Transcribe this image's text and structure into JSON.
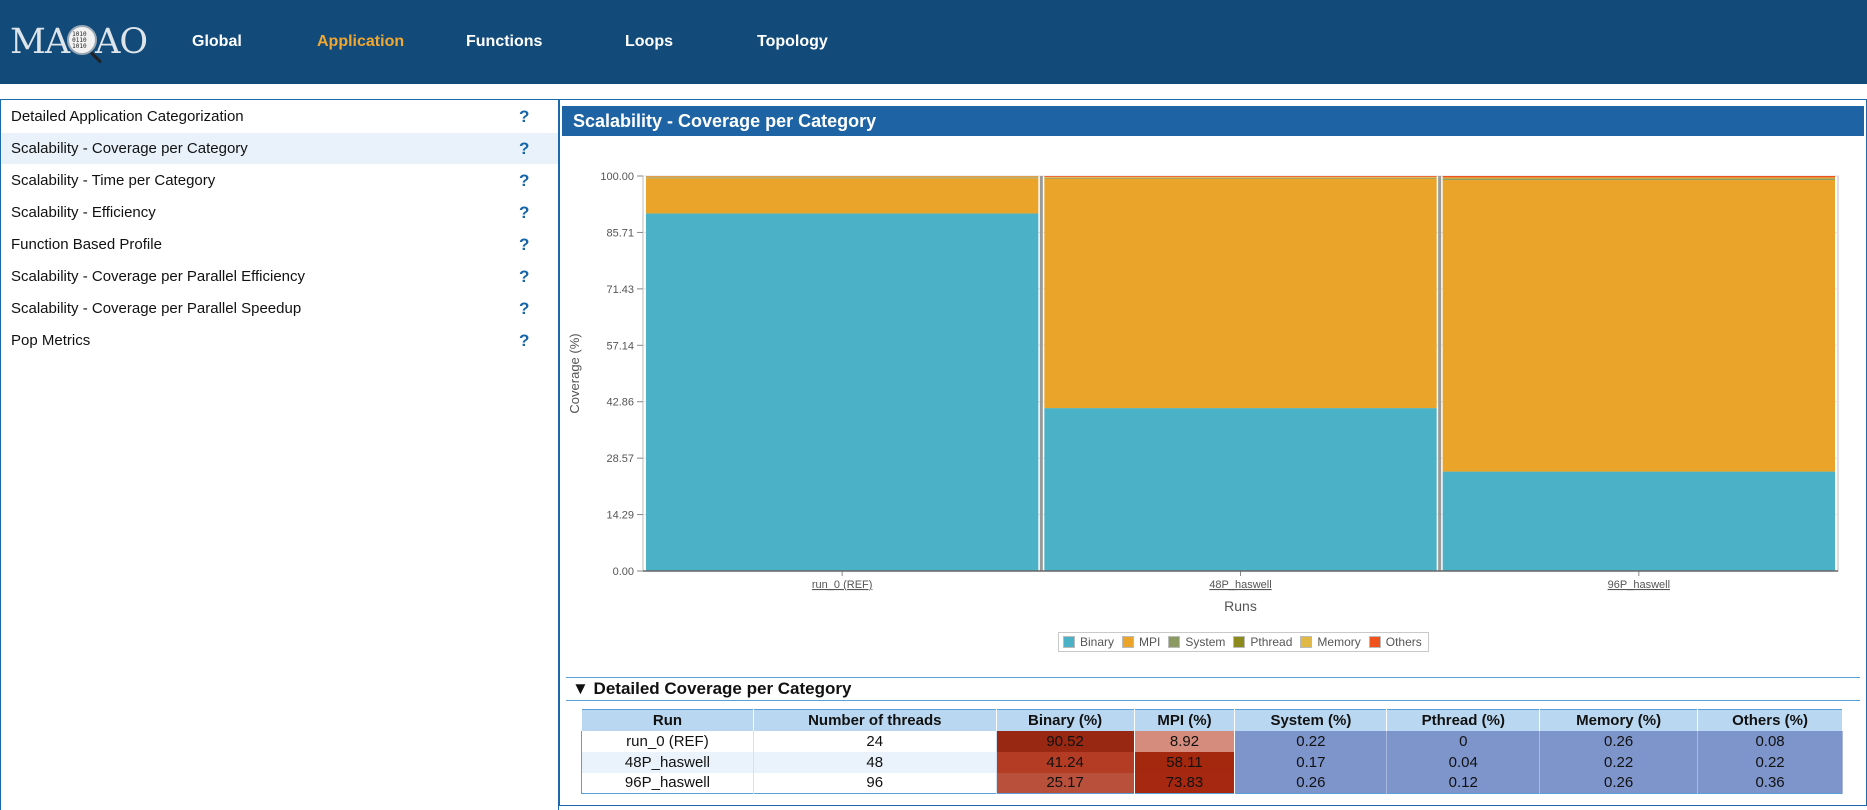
{
  "header": {
    "logo_text_left": "MA",
    "logo_text_right": "AO",
    "logo_glass_bits": "1010\n0110\n1010",
    "nav": [
      {
        "label": "Global",
        "active": false
      },
      {
        "label": "Application",
        "active": true
      },
      {
        "label": "Functions",
        "active": false
      },
      {
        "label": "Loops",
        "active": false
      },
      {
        "label": "Topology",
        "active": false
      }
    ]
  },
  "sidebar": {
    "help_glyph": "?",
    "items": [
      {
        "label": "Detailed Application Categorization",
        "selected": false
      },
      {
        "label": "Scalability - Coverage per Category",
        "selected": true
      },
      {
        "label": "Scalability - Time per Category",
        "selected": false
      },
      {
        "label": "Scalability - Efficiency",
        "selected": false
      },
      {
        "label": "Function Based Profile",
        "selected": false
      },
      {
        "label": "Scalability - Coverage per Parallel Efficiency",
        "selected": false
      },
      {
        "label": "Scalability - Coverage per Parallel Speedup",
        "selected": false
      },
      {
        "label": "Pop Metrics",
        "selected": false
      }
    ]
  },
  "panel": {
    "title": "Scalability - Coverage per Category",
    "section_title": "▼ Detailed Coverage per Category"
  },
  "colors": {
    "header_bg": "#124a7a",
    "accent": "#f0a830",
    "panel_title_bg": "#1e64a4",
    "binary": "#4ab1c6",
    "mpi": "#eaa42a",
    "system": "#8a9a62",
    "pthread": "#8c8a1c",
    "memory": "#e0b846",
    "others": "#f0521e",
    "table_blue": "#7e95cc"
  },
  "chart_data": {
    "type": "bar",
    "stacked": true,
    "categories": [
      "run_0 (REF)",
      "48P_haswell",
      "96P_haswell"
    ],
    "xlabel": "Runs",
    "ylabel": "Coverage (%)",
    "ylim": [
      0,
      100
    ],
    "yticks": [
      "0.00",
      "14.29",
      "28.57",
      "42.86",
      "57.14",
      "71.43",
      "85.71",
      "100.00"
    ],
    "grid": true,
    "legend_position": "bottom",
    "series": [
      {
        "name": "Binary",
        "color": "#4ab1c6",
        "values": [
          90.52,
          41.24,
          25.17
        ]
      },
      {
        "name": "MPI",
        "color": "#eaa42a",
        "values": [
          8.92,
          58.11,
          73.83
        ]
      },
      {
        "name": "System",
        "color": "#8a9a62",
        "values": [
          0.22,
          0.17,
          0.26
        ]
      },
      {
        "name": "Pthread",
        "color": "#8c8a1c",
        "values": [
          0,
          0.04,
          0.12
        ]
      },
      {
        "name": "Memory",
        "color": "#e0b846",
        "values": [
          0.26,
          0.22,
          0.26
        ]
      },
      {
        "name": "Others",
        "color": "#f0521e",
        "values": [
          0.08,
          0.22,
          0.36
        ]
      }
    ]
  },
  "table": {
    "headers": [
      "Run",
      "Number of threads",
      "Binary (%)",
      "MPI (%)",
      "System (%)",
      "Pthread (%)",
      "Memory (%)",
      "Others (%)"
    ],
    "rows": [
      {
        "run": "run_0 (REF)",
        "threads": "24",
        "binary": "90.52",
        "mpi": "8.92",
        "system": "0.22",
        "pthread": "0",
        "memory": "0.26",
        "others": "0.08"
      },
      {
        "run": "48P_haswell",
        "threads": "48",
        "binary": "41.24",
        "mpi": "58.11",
        "system": "0.17",
        "pthread": "0.04",
        "memory": "0.22",
        "others": "0.22"
      },
      {
        "run": "96P_haswell",
        "threads": "96",
        "binary": "25.17",
        "mpi": "73.83",
        "system": "0.26",
        "pthread": "0.12",
        "memory": "0.26",
        "others": "0.36"
      }
    ],
    "cell_colors": [
      {
        "binary": "#982812",
        "mpi": "#d58c7c"
      },
      {
        "binary": "#b53c24",
        "mpi": "#a4280e"
      },
      {
        "binary": "#b8503c",
        "mpi": "#a62810"
      }
    ]
  }
}
